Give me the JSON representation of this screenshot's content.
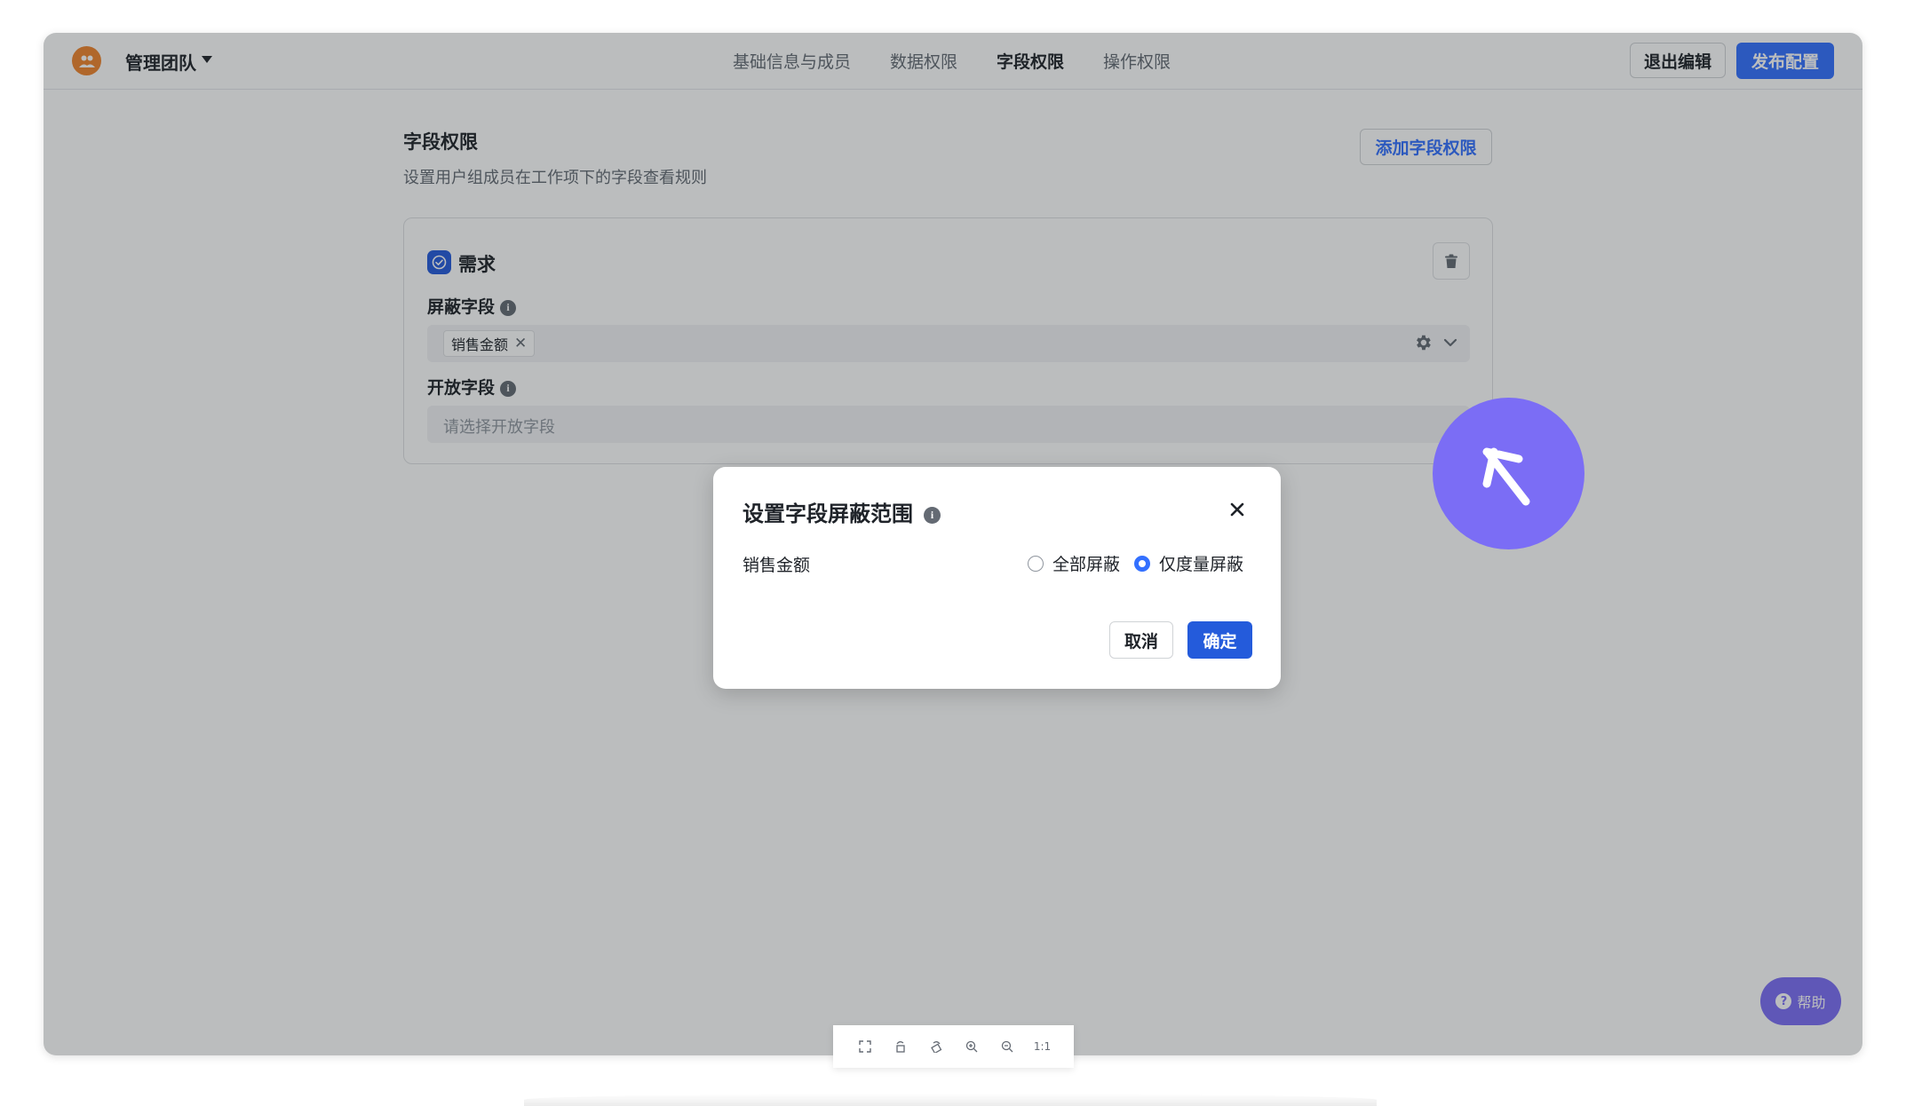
{
  "team": {
    "name": "管理团队"
  },
  "nav": {
    "tabs": [
      "基础信息与成员",
      "数据权限",
      "字段权限",
      "操作权限"
    ],
    "active": 2
  },
  "toolbar": {
    "exit_label": "退出编辑",
    "publish_label": "发布配置"
  },
  "section": {
    "title": "字段权限",
    "description": "设置用户组成员在工作项下的字段查看规则",
    "add_label": "添加字段权限"
  },
  "card": {
    "title": "需求",
    "masked": {
      "label": "屏蔽字段",
      "tag": "销售金额"
    },
    "open": {
      "label": "开放字段",
      "placeholder": "请选择开放字段"
    }
  },
  "modal": {
    "title": "设置字段屏蔽范围",
    "field": "销售金额",
    "options": [
      "全部屏蔽",
      "仅度量屏蔽"
    ],
    "selected": 1,
    "cancel_label": "取消",
    "ok_label": "确定"
  },
  "help": {
    "label": "帮助"
  },
  "viewer": {
    "ratio_label": "1:1"
  },
  "colors": {
    "accent": "#3370ff",
    "brand_dark": "#245bdb",
    "cursor": "#7b6df5",
    "team_logo": "#f0852d"
  }
}
